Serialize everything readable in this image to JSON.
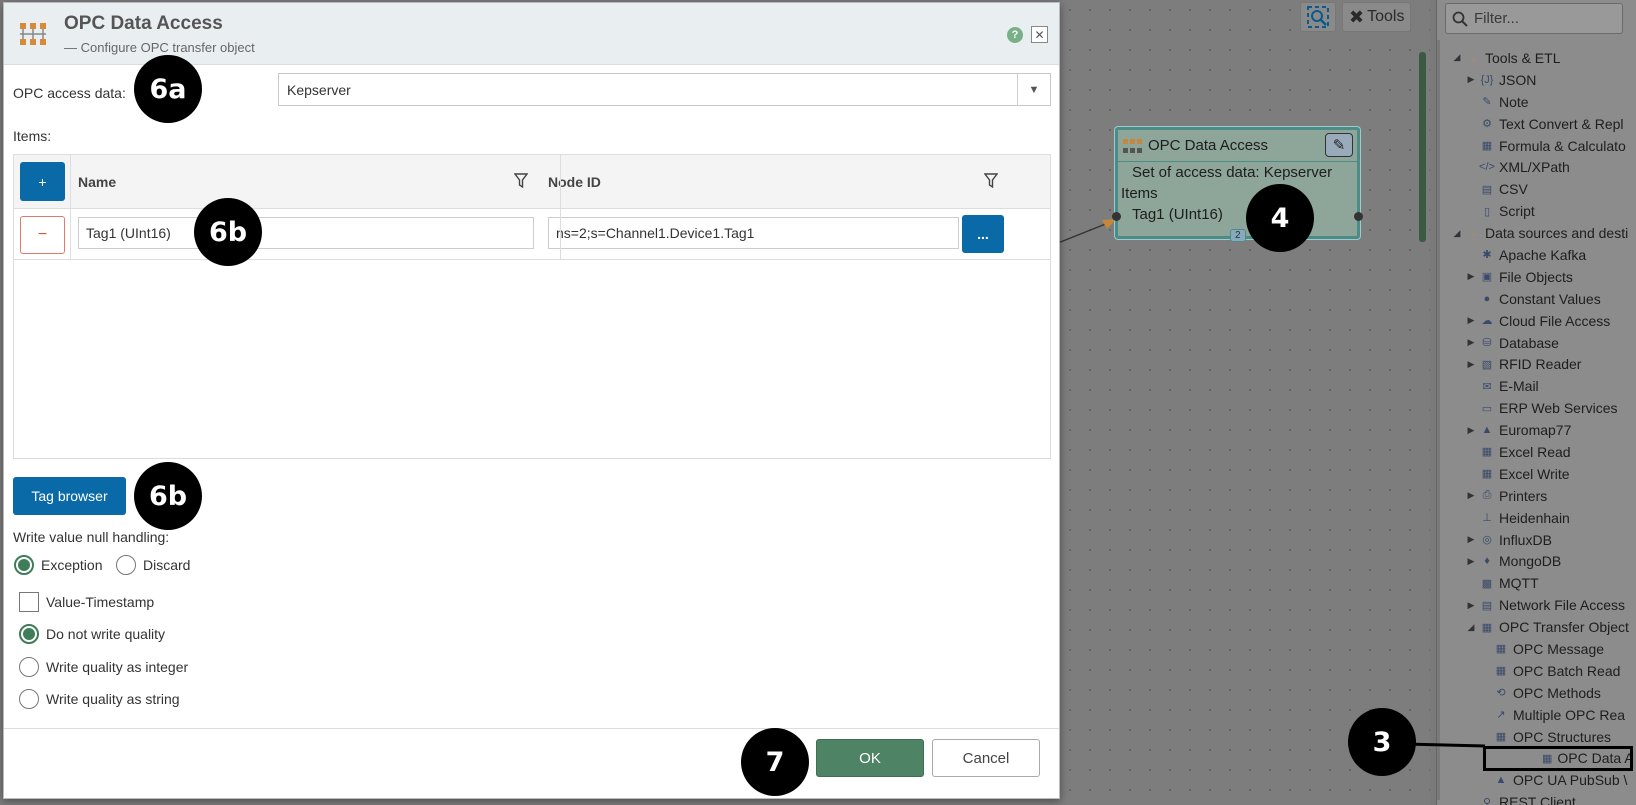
{
  "canvas": {
    "toolbar": {
      "tools_label": "Tools"
    },
    "node": {
      "title": "OPC Data Access",
      "line1": "Set of access data: Kepserver",
      "line2": "Items",
      "line3": "Tag1 (UInt16)",
      "count": "2"
    }
  },
  "palette": {
    "search_placeholder": "Filter...",
    "items": [
      {
        "label": "Tools & ETL",
        "depth": 0,
        "arrow": "◢",
        "icon": "→"
      },
      {
        "label": "JSON",
        "depth": 1,
        "arrow": "▶",
        "icon": "{J}"
      },
      {
        "label": "Note",
        "depth": 1,
        "arrow": "",
        "icon": "✎"
      },
      {
        "label": "Text Convert & Repl",
        "depth": 1,
        "arrow": "",
        "icon": "⚙"
      },
      {
        "label": "Formula & Calculato",
        "depth": 1,
        "arrow": "",
        "icon": "▦"
      },
      {
        "label": "XML/XPath",
        "depth": 1,
        "arrow": "",
        "icon": "</>"
      },
      {
        "label": "CSV",
        "depth": 1,
        "arrow": "",
        "icon": "▤"
      },
      {
        "label": "Script",
        "depth": 1,
        "arrow": "",
        "icon": "▯"
      },
      {
        "label": "Data sources and desti",
        "depth": 0,
        "arrow": "◢",
        "icon": "→"
      },
      {
        "label": "Apache Kafka",
        "depth": 1,
        "arrow": "",
        "icon": "✱"
      },
      {
        "label": "File Objects",
        "depth": 1,
        "arrow": "▶",
        "icon": "▣"
      },
      {
        "label": "Constant Values",
        "depth": 1,
        "arrow": "",
        "icon": "●"
      },
      {
        "label": "Cloud File Access",
        "depth": 1,
        "arrow": "▶",
        "icon": "☁"
      },
      {
        "label": "Database",
        "depth": 1,
        "arrow": "▶",
        "icon": "⛁"
      },
      {
        "label": "RFID Reader",
        "depth": 1,
        "arrow": "▶",
        "icon": "▧"
      },
      {
        "label": "E-Mail",
        "depth": 1,
        "arrow": "",
        "icon": "✉"
      },
      {
        "label": "ERP Web Services",
        "depth": 1,
        "arrow": "",
        "icon": "▭"
      },
      {
        "label": "Euromap77",
        "depth": 1,
        "arrow": "▶",
        "icon": "▲"
      },
      {
        "label": "Excel Read",
        "depth": 1,
        "arrow": "",
        "icon": "▦"
      },
      {
        "label": "Excel Write",
        "depth": 1,
        "arrow": "",
        "icon": "▦"
      },
      {
        "label": "Printers",
        "depth": 1,
        "arrow": "▶",
        "icon": "⎙"
      },
      {
        "label": "Heidenhain",
        "depth": 1,
        "arrow": "",
        "icon": "⊥"
      },
      {
        "label": "InfluxDB",
        "depth": 1,
        "arrow": "▶",
        "icon": "◎"
      },
      {
        "label": "MongoDB",
        "depth": 1,
        "arrow": "▶",
        "icon": "♦"
      },
      {
        "label": "MQTT",
        "depth": 1,
        "arrow": "",
        "icon": "▩"
      },
      {
        "label": "Network File Access",
        "depth": 1,
        "arrow": "▶",
        "icon": "▤"
      },
      {
        "label": "OPC Transfer Object",
        "depth": 1,
        "arrow": "◢",
        "icon": "▦"
      },
      {
        "label": "OPC Message",
        "depth": 2,
        "arrow": "",
        "icon": "▦"
      },
      {
        "label": "OPC Batch Read",
        "depth": 2,
        "arrow": "",
        "icon": "▦"
      },
      {
        "label": "OPC Methods",
        "depth": 2,
        "arrow": "",
        "icon": "⟲"
      },
      {
        "label": "Multiple OPC Rea",
        "depth": 2,
        "arrow": "",
        "icon": "↗"
      },
      {
        "label": "OPC Structures",
        "depth": 2,
        "arrow": "",
        "icon": "▦"
      },
      {
        "label": "OPC Data Access",
        "depth": 2,
        "arrow": "",
        "icon": "▦",
        "highlight": true
      },
      {
        "label": "OPC UA PubSub \\",
        "depth": 2,
        "arrow": "",
        "icon": "▲"
      },
      {
        "label": "REST Client",
        "depth": 1,
        "arrow": "",
        "icon": "⚲"
      }
    ]
  },
  "dialog": {
    "title": "OPC Data Access",
    "subtitle": "— Configure OPC transfer object",
    "help_label": "?",
    "close_label": "✕",
    "access_label": "OPC access data:",
    "access_value": "Kepserver",
    "items_label": "Items:",
    "grid": {
      "add_label": "+",
      "remove_label": "−",
      "col_name": "Name",
      "col_node": "Node ID",
      "rows": [
        {
          "name": "Tag1 (UInt16)",
          "node_id": "ns=2;s=Channel1.Device1.Tag1"
        }
      ],
      "browse_label": "..."
    },
    "tag_browser_label": "Tag browser",
    "null_handling_label": "Write value null handling:",
    "opt_exception": "Exception",
    "opt_discard": "Discard",
    "opt_value_timestamp": "Value-Timestamp",
    "opt_no_quality": "Do not write quality",
    "opt_quality_int": "Write quality as integer",
    "opt_quality_str": "Write quality as string",
    "ok_label": "OK",
    "cancel_label": "Cancel"
  },
  "callouts": {
    "c6a": "6a",
    "c6b_grid": "6b",
    "c6b_browser": "6b",
    "c4": "4",
    "c3": "3",
    "c7": "7"
  },
  "colors": {
    "primary_button": "#0a6aa8",
    "ok_button": "#4e8366",
    "radio_selected": "#3f7c5a"
  }
}
